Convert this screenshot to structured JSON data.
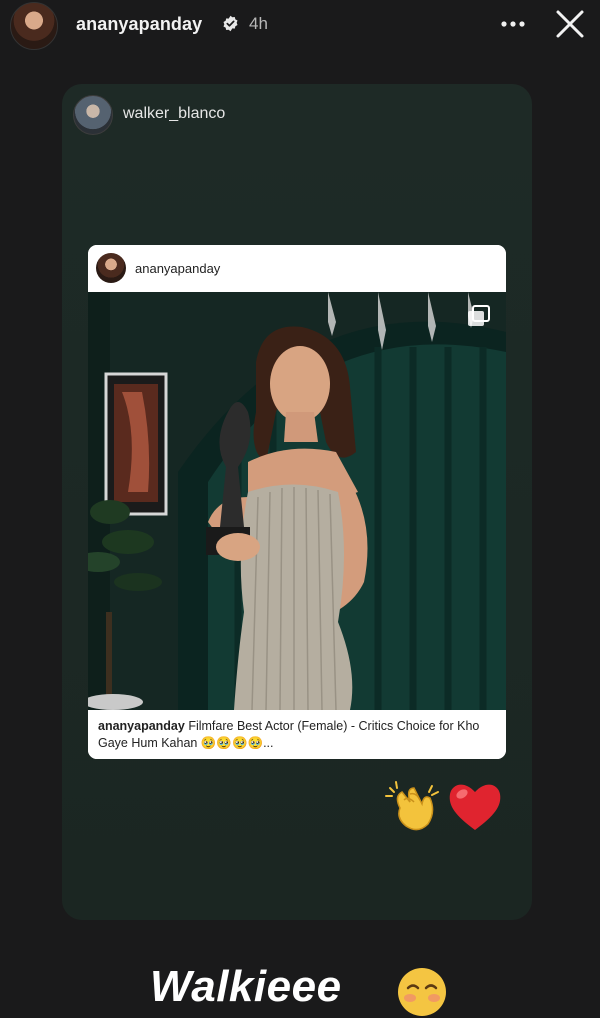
{
  "header": {
    "username": "ananyapanday",
    "time_ago": "4h",
    "icons": {
      "verified": "verified-badge-icon",
      "more": "more-options-icon",
      "close": "close-icon"
    }
  },
  "shared_card": {
    "sharer_username": "walker_blanco",
    "post": {
      "username": "ananyapanday",
      "caption_user": "ananyapanday",
      "caption_text": "Filmfare Best Actor (Female) - Critics Choice for Kho Gaye Hum Kahan 🥹🥹🥹🥹...",
      "photo_icon": "multiple-photos-icon"
    },
    "reactions": [
      "clapping-hands-icon",
      "red-heart-icon"
    ]
  },
  "story_text": {
    "text": "Walkieee",
    "emoji": "smiling-face-icon"
  },
  "colors": {
    "background": "#1a1a1b",
    "card": "#1e2a26",
    "heart": "#e0242f"
  }
}
